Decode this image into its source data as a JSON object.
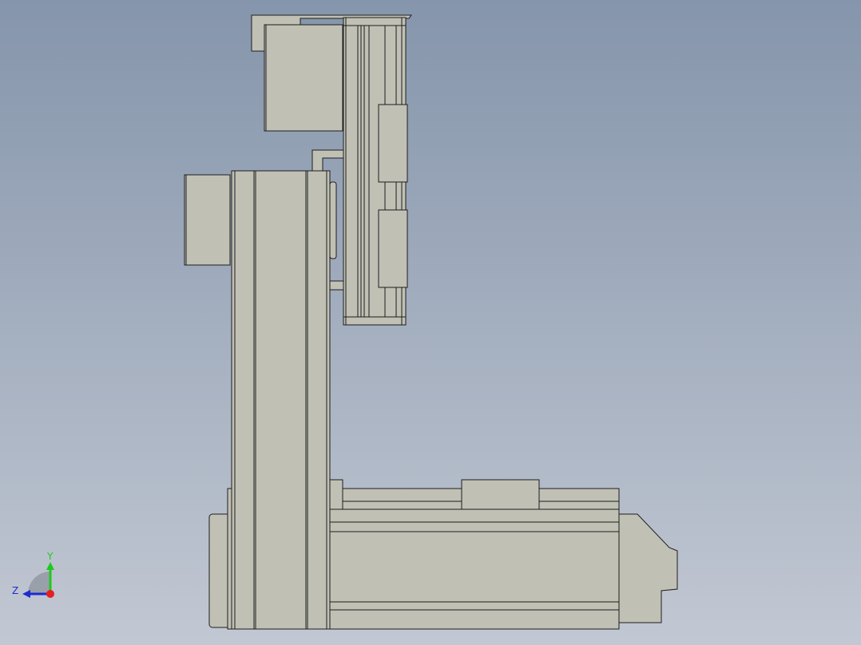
{
  "viewport": {
    "background_top": "#8595ab",
    "background_bottom": "#c2c8d3",
    "part_color": "#c0c0b5",
    "edge_color": "#1e1e1e"
  },
  "triad": {
    "y_label": "Y",
    "z_label": "Z",
    "y_color": "#1ec81e",
    "z_color": "#1e2ad2",
    "x_color": "#e61e1e"
  }
}
